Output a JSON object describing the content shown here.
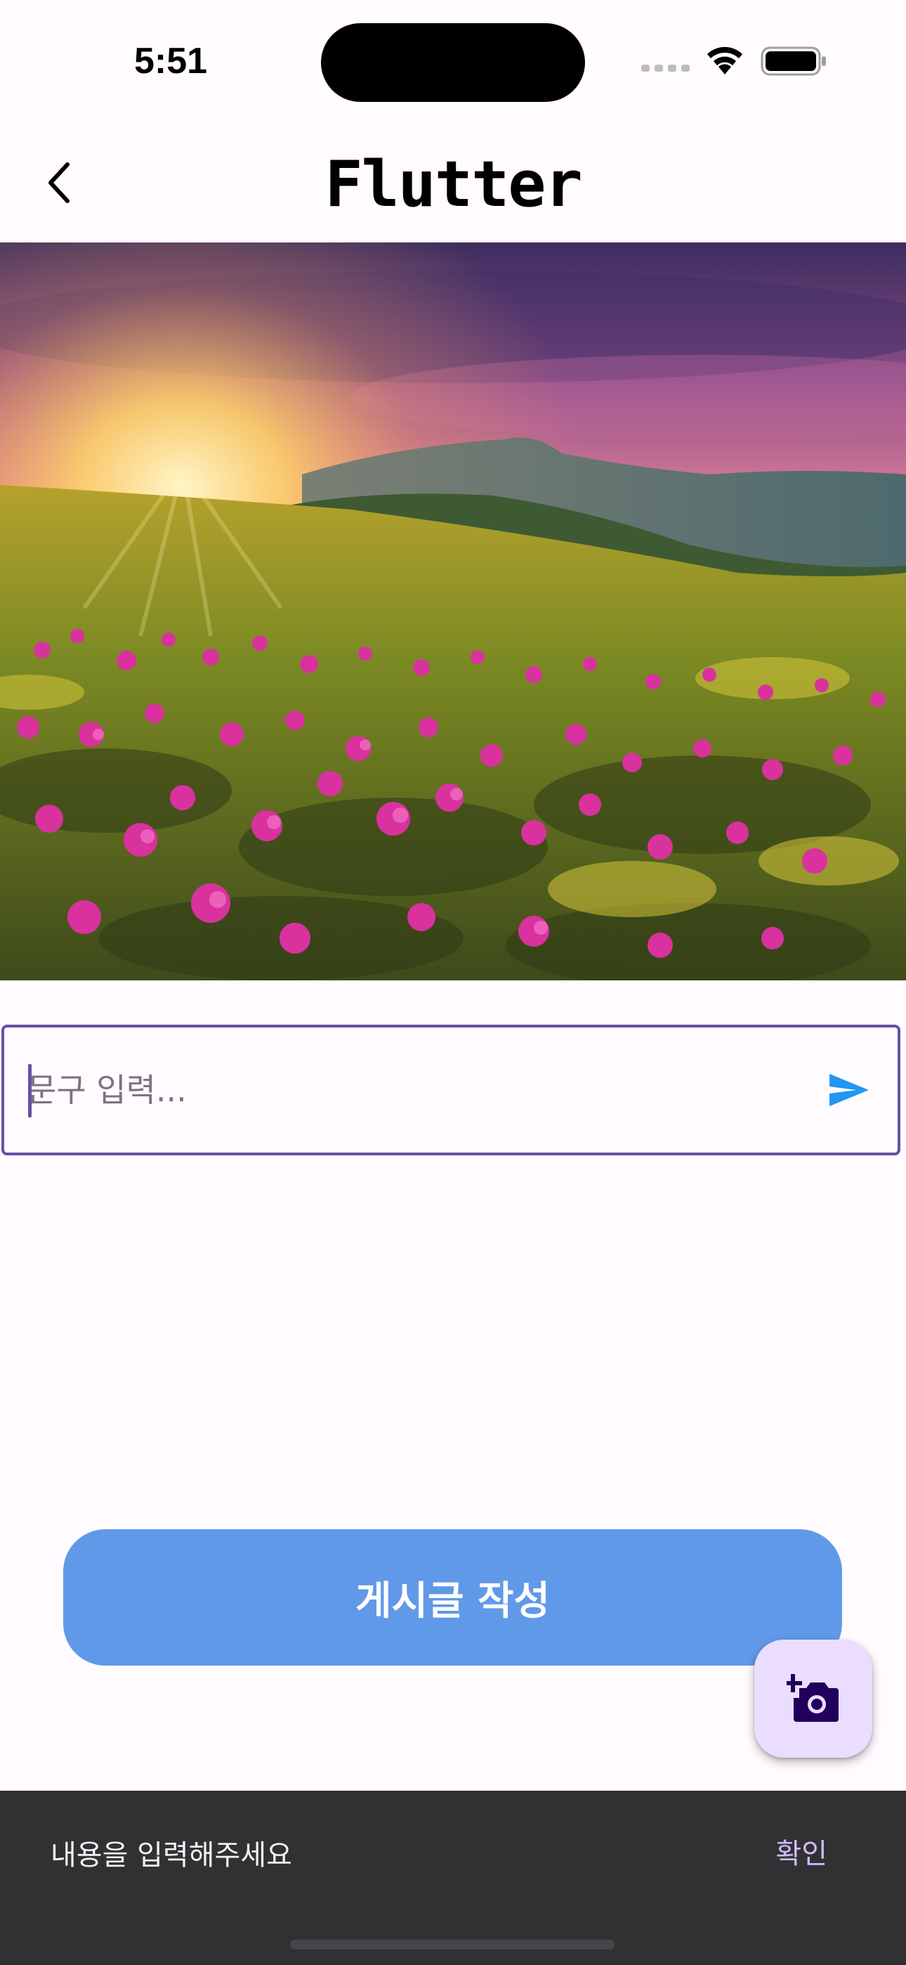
{
  "status_bar": {
    "time": "5:51",
    "icons": [
      "signal-dots-icon",
      "wifi-icon",
      "battery-icon"
    ]
  },
  "app_bar": {
    "title": "Flutter",
    "back_icon": "chevron-left-icon"
  },
  "hero_image": {
    "subject": "sunrise over mountain meadow with pink flowers"
  },
  "input": {
    "placeholder": "문구 입력...",
    "value": "",
    "send_icon": "send-icon"
  },
  "post_button": {
    "label": "게시글 작성"
  },
  "fab": {
    "icon": "add-photo-camera-icon"
  },
  "snackbar": {
    "message": "내용을 입력해주세요",
    "action_label": "확인"
  },
  "colors": {
    "background": "#FFFBFE",
    "primary": "#6750A4",
    "post_button": "#6199E9",
    "send_icon": "#2196F3",
    "fab": "#EADDFF",
    "fab_icon": "#21005D",
    "snackbar": "#313033",
    "snackbar_action": "#D0BCFF"
  }
}
